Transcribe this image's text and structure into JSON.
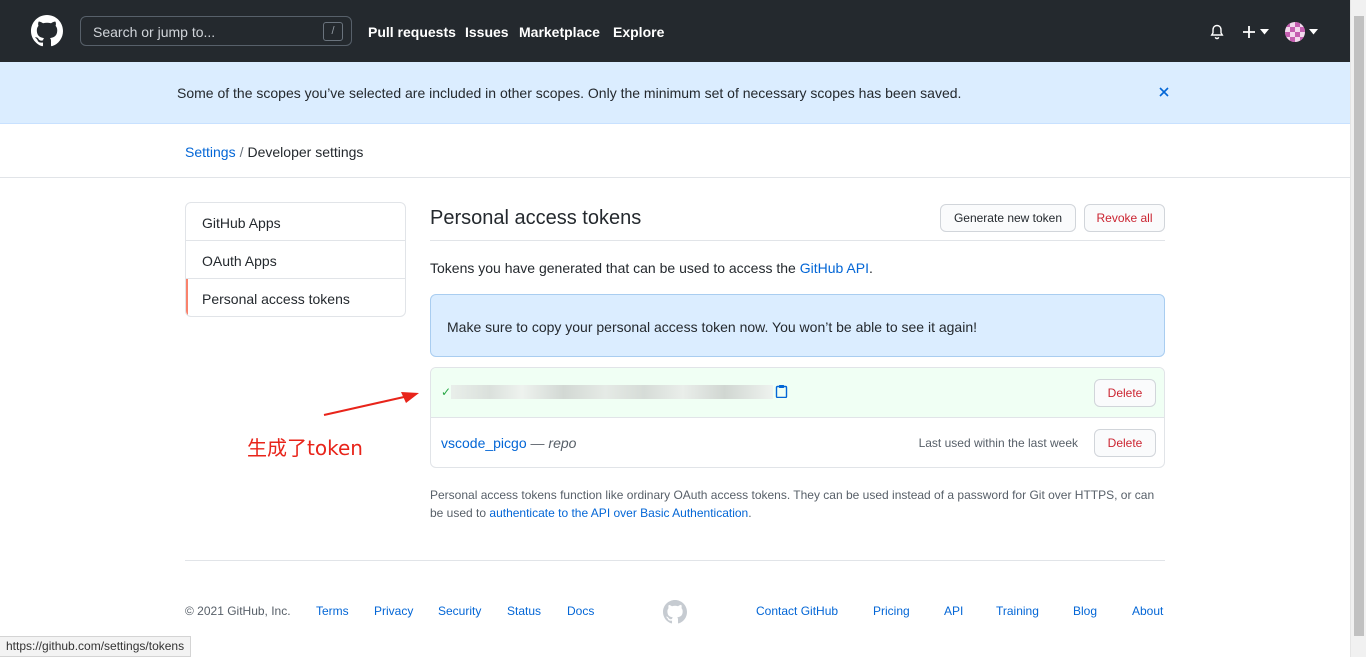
{
  "header": {
    "search_placeholder": "Search or jump to...",
    "slash_key": "/",
    "nav": [
      "Pull requests",
      "Issues",
      "Marketplace",
      "Explore"
    ]
  },
  "flash": {
    "message": "Some of the scopes you’ve selected are included in other scopes. Only the minimum set of necessary scopes has been saved."
  },
  "breadcrumb": {
    "parent": "Settings",
    "separator": "/",
    "current": "Developer settings"
  },
  "sidebar": {
    "items": [
      {
        "label": "GitHub Apps"
      },
      {
        "label": "OAuth Apps"
      },
      {
        "label": "Personal access tokens"
      }
    ]
  },
  "main": {
    "title": "Personal access tokens",
    "generate_label": "Generate new token",
    "revoke_label": "Revoke all",
    "intro_prefix": "Tokens you have generated that can be used to access the ",
    "intro_link": "GitHub API",
    "intro_suffix": ".",
    "notice": "Make sure to copy your personal access token now. You won’t be able to see it again!",
    "delete_label": "Delete",
    "token_name": "vscode_picgo",
    "token_scope_sep": " — ",
    "token_scope": "repo",
    "last_used": "Last used within the last week",
    "foot_prefix": "Personal access tokens function like ordinary OAuth access tokens. They can be used instead of a password for Git over HTTPS, or can be used to ",
    "foot_link": "authenticate to the API over Basic Authentication",
    "foot_suffix": "."
  },
  "annotation": {
    "text": "生成了token",
    "color": "#e8241a"
  },
  "footer": {
    "copyright": "© 2021 GitHub, Inc.",
    "left_links": [
      "Terms",
      "Privacy",
      "Security",
      "Status",
      "Docs"
    ],
    "right_links": [
      "Contact GitHub",
      "Pricing",
      "API",
      "Training",
      "Blog",
      "About"
    ]
  },
  "statusbar": {
    "url": "https://github.com/settings/tokens"
  },
  "colors": {
    "header_bg": "#24292e",
    "link": "#0366d6",
    "danger": "#cb2431",
    "flash_bg": "#dbedff",
    "success_bg": "#f0fff4"
  }
}
